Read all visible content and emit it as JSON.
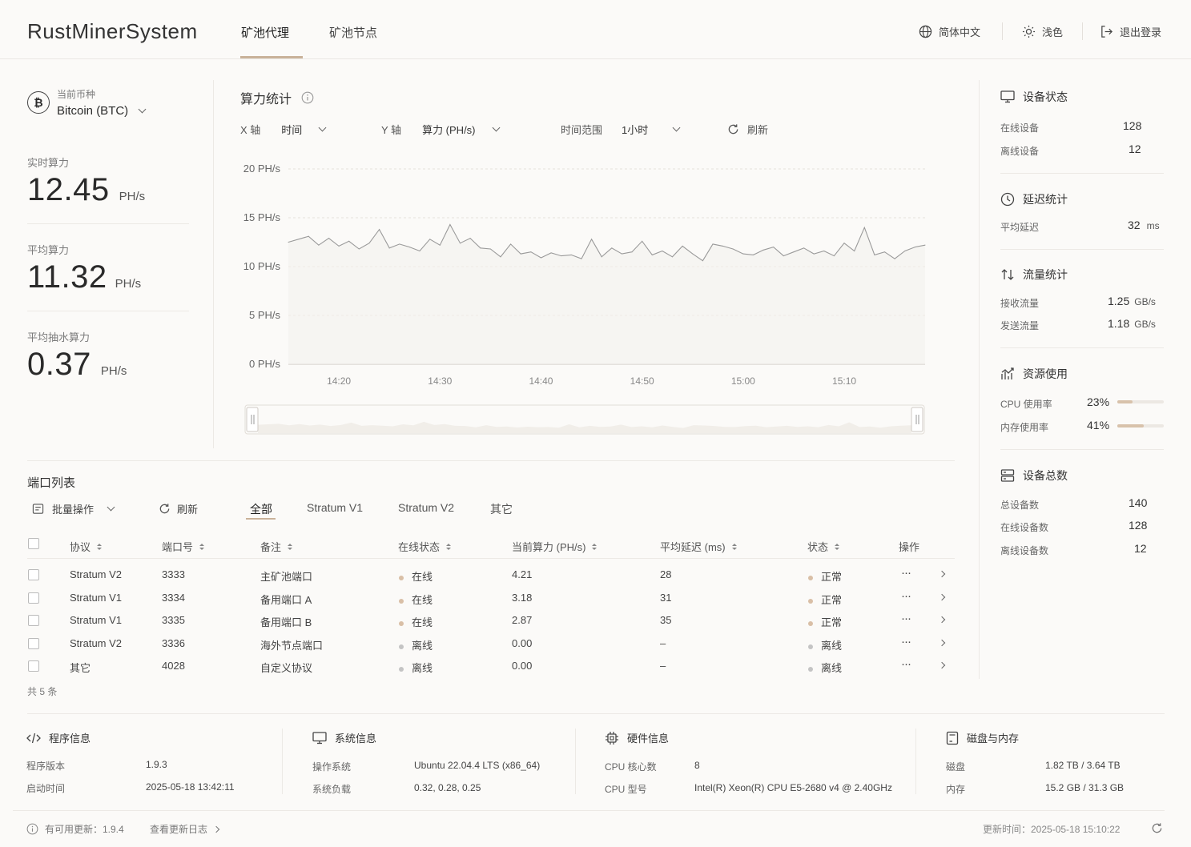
{
  "app": {
    "title": "RustMinerSystem"
  },
  "nav": {
    "tabs": [
      {
        "label": "矿池代理"
      },
      {
        "label": "矿池节点"
      }
    ],
    "language": "简体中文",
    "theme": "浅色",
    "logout": "退出登录"
  },
  "coin": {
    "label": "当前币种",
    "value": "Bitcoin (BTC)"
  },
  "stats": {
    "realtime": {
      "label": "实时算力",
      "value": "12.45",
      "unit": "PH/s"
    },
    "average": {
      "label": "平均算力",
      "value": "11.32",
      "unit": "PH/s"
    },
    "fee": {
      "label": "平均抽水算力",
      "value": "0.37",
      "unit": "PH/s"
    }
  },
  "chart": {
    "title": "算力统计",
    "x_axis_label": "X 轴",
    "x_axis_value": "时间",
    "y_axis_label": "Y 轴",
    "y_axis_value": "算力 (PH/s)",
    "range_label": "时间范围",
    "range_value": "1小时",
    "refresh": "刷新"
  },
  "chart_data": {
    "type": "line",
    "y_ticks": [
      "20 PH/s",
      "15 PH/s",
      "10 PH/s",
      "5 PH/s",
      "0 PH/s"
    ],
    "x_ticks": [
      "14:20",
      "14:30",
      "14:40",
      "14:50",
      "15:00",
      "15:10"
    ],
    "ylim": [
      0,
      20
    ],
    "xlim_minutes": [
      14.15,
      15.18
    ],
    "grid": true,
    "series": [
      {
        "x": [
          14.15,
          14.17,
          14.18,
          14.19,
          14.2,
          14.21,
          14.22,
          14.23,
          14.24,
          14.25,
          14.26,
          14.27,
          14.28,
          14.29,
          14.3,
          14.31,
          14.32,
          14.33,
          14.34,
          14.35,
          14.36,
          14.37,
          14.38,
          14.39,
          14.4,
          14.41,
          14.42,
          14.43,
          14.44,
          14.45,
          14.46,
          14.47,
          14.48,
          14.49,
          14.5,
          14.51,
          14.52,
          14.53,
          14.54,
          14.55,
          14.56,
          14.57,
          14.58,
          14.59,
          15.0,
          15.01,
          15.02,
          15.03,
          15.04,
          15.05,
          15.06,
          15.07,
          15.08,
          15.09,
          15.1,
          15.11,
          15.12,
          15.13,
          15.14,
          15.15,
          15.16,
          15.17,
          15.18
        ],
        "values": [
          12.5,
          13.1,
          12.2,
          12.9,
          12.1,
          12.6,
          11.8,
          12.4,
          13.8,
          11.9,
          12.3,
          12.0,
          11.6,
          12.8,
          12.2,
          14.3,
          12.4,
          12.9,
          11.9,
          11.8,
          11.0,
          12.3,
          11.3,
          11.5,
          10.9,
          11.4,
          11.1,
          11.2,
          10.8,
          12.8,
          11.0,
          11.9,
          11.3,
          11.5,
          12.6,
          11.2,
          11.6,
          11.0,
          12.1,
          11.3,
          10.6,
          12.3,
          12.1,
          11.8,
          11.3,
          11.2,
          11.7,
          12.0,
          11.1,
          11.5,
          11.9,
          11.3,
          11.6,
          11.1,
          12.4,
          11.6,
          14.0,
          11.2,
          11.5,
          10.8,
          11.6,
          12.0,
          12.2
        ]
      }
    ]
  },
  "device_status": {
    "title": "设备状态",
    "online_label": "在线设备",
    "online": "128",
    "offline_label": "离线设备",
    "offline": "12"
  },
  "latency": {
    "title": "延迟统计",
    "avg_label": "平均延迟",
    "avg": "32",
    "unit": "ms"
  },
  "traffic": {
    "title": "流量统计",
    "recv_label": "接收流量",
    "recv": "1.25",
    "send_label": "发送流量",
    "send": "1.18",
    "unit": "GB/s"
  },
  "resource": {
    "title": "资源使用",
    "cpu_label": "CPU 使用率",
    "cpu": "23%",
    "cpu_frac": 0.23,
    "mem_label": "内存使用率",
    "mem": "41%",
    "mem_frac": 0.41
  },
  "device_total": {
    "title": "设备总数",
    "total_label": "总设备数",
    "total": "140",
    "online_label": "在线设备数",
    "online": "128",
    "offline_label": "离线设备数",
    "offline": "12"
  },
  "ports": {
    "title": "端口列表",
    "batch": "批量操作",
    "refresh": "刷新",
    "filters": [
      "全部",
      "Stratum V1",
      "Stratum V2",
      "其它"
    ],
    "columns": [
      "协议",
      "端口号",
      "备注",
      "在线状态",
      "当前算力 (PH/s)",
      "平均延迟 (ms)",
      "状态",
      "操作"
    ],
    "rows": [
      {
        "protocol": "Stratum V2",
        "port": "3333",
        "note": "主矿池端口",
        "online": "在线",
        "hash": "4.21",
        "latency": "28",
        "status": "正常",
        "on": true
      },
      {
        "protocol": "Stratum V1",
        "port": "3334",
        "note": "备用端口 A",
        "online": "在线",
        "hash": "3.18",
        "latency": "31",
        "status": "正常",
        "on": true
      },
      {
        "protocol": "Stratum V1",
        "port": "3335",
        "note": "备用端口 B",
        "online": "在线",
        "hash": "2.87",
        "latency": "35",
        "status": "正常",
        "on": true
      },
      {
        "protocol": "Stratum V2",
        "port": "3336",
        "note": "海外节点端口",
        "online": "离线",
        "hash": "0.00",
        "latency": "–",
        "status": "离线",
        "on": false
      },
      {
        "protocol": "其它",
        "port": "4028",
        "note": "自定义协议",
        "online": "离线",
        "hash": "0.00",
        "latency": "–",
        "status": "离线",
        "on": false
      }
    ],
    "total": "共 5 条",
    "more": "···"
  },
  "info": {
    "program": {
      "title": "程序信息",
      "version_label": "程序版本",
      "version": "1.9.3",
      "start_label": "启动时间",
      "start": "2025-05-18 13:42:11"
    },
    "system": {
      "title": "系统信息",
      "os_label": "操作系统",
      "os": "Ubuntu 22.04.4 LTS (x86_64)",
      "load_label": "系统负载",
      "load": "0.32, 0.28, 0.25"
    },
    "hardware": {
      "title": "硬件信息",
      "cores_label": "CPU 核心数",
      "cores": "8",
      "model_label": "CPU 型号",
      "model": "Intel(R) Xeon(R) CPU E5-2680 v4 @ 2.40GHz"
    },
    "disk": {
      "title": "磁盘与内存",
      "disk_label": "磁盘",
      "disk": "1.82 TB / 3.64 TB",
      "mem_label": "内存",
      "mem": "15.2 GB / 31.3 GB"
    }
  },
  "footer": {
    "update": "有可用更新：1.9.4",
    "changelog": "查看更新日志",
    "updated": "更新时间：2025-05-18 15:10:22"
  },
  "colors": {
    "accent": "#c9b29a",
    "online_dot": "#d9bfa6",
    "offline_dot": "#c4c4c4",
    "line": "#9a9a9a"
  }
}
